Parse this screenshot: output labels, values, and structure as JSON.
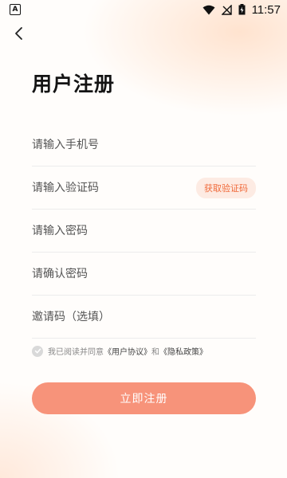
{
  "status_bar": {
    "time": "11:57",
    "app_indicator": "A",
    "icons": [
      "wifi-icon",
      "signal-off-icon",
      "battery-charging-icon"
    ]
  },
  "nav": {
    "back_icon": "chevron-left-icon"
  },
  "page": {
    "title": "用户注册"
  },
  "form": {
    "phone_placeholder": "请输入手机号",
    "code_placeholder": "请输入验证码",
    "get_code_label": "获取验证码",
    "password_placeholder": "请输入密码",
    "confirm_placeholder": "请确认密码",
    "invite_placeholder": "邀请码（选填）"
  },
  "agreement": {
    "prefix": "我已阅读并同意",
    "user_agreement": "《用户协议》",
    "and": "和",
    "privacy_policy": "《隐私政策》",
    "checked": false
  },
  "submit": {
    "label": "立即注册"
  },
  "colors": {
    "accent": "#f7937a",
    "code_button_text": "#f06a3a",
    "code_button_bg": "#fdebe3"
  }
}
